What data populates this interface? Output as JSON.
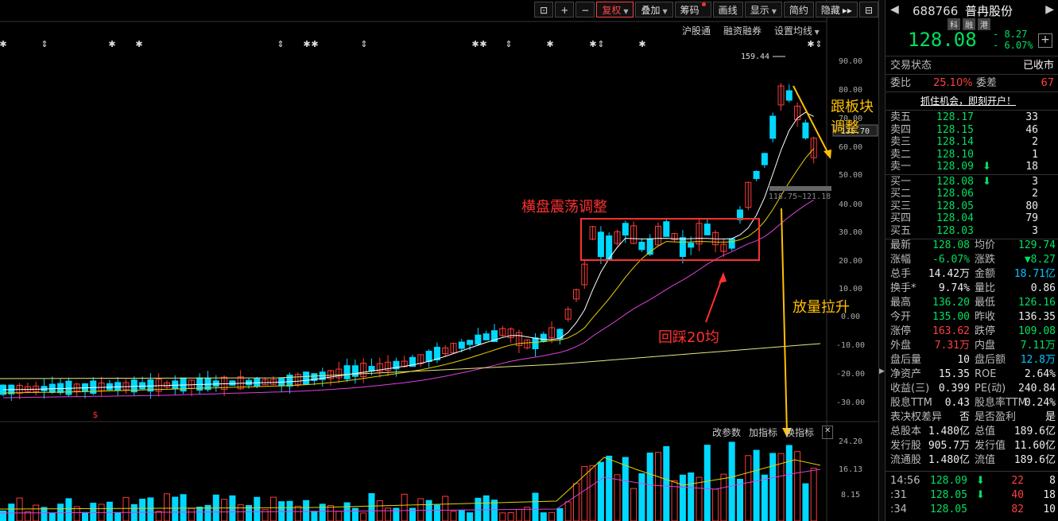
{
  "toolbar": {
    "buttons": [
      "复权",
      "叠加",
      "筹码",
      "画线",
      "显示",
      "简约",
      "隐藏"
    ]
  },
  "subtools": [
    "沪股通",
    "融资融券",
    "设置均线"
  ],
  "volume_tools": [
    "改参数",
    "加指标",
    "换指标"
  ],
  "annotations": {
    "sideways": "横盘震荡调整",
    "pullback": "回踩20均",
    "sector": "跟板块调整",
    "volume": "放量拉升",
    "high_marker": "159.44",
    "range_label": "118.75~121.18",
    "price_tag": "135.70",
    "s_marker": "$"
  },
  "price_axis": [
    "90.00",
    "80.00",
    "70.00",
    "60.00",
    "50.00",
    "40.00",
    "30.00",
    "20.00",
    "10.00",
    "0.00",
    "-10.00",
    "-20.00",
    "-30.00"
  ],
  "volume_axis": [
    "24.20",
    "16.13",
    "8.15"
  ],
  "quote": {
    "code": "688766",
    "name": "普冉股份",
    "tags": [
      "科",
      "融",
      "港"
    ],
    "price": "128.08",
    "change": "- 8.27",
    "change_pct": "- 6.07%",
    "status_label": "交易状态",
    "status_value": "已收市",
    "weibi_label": "委比",
    "weibi_value": "25.10%",
    "weicha_label": "委差",
    "weicha_value": "67",
    "promo": "抓住机会，即刻开户！",
    "sell": [
      {
        "label": "卖五",
        "price": "128.17",
        "vol": "33"
      },
      {
        "label": "卖四",
        "price": "128.15",
        "vol": "46"
      },
      {
        "label": "卖三",
        "price": "128.14",
        "vol": "2"
      },
      {
        "label": "卖二",
        "price": "128.10",
        "vol": "1"
      },
      {
        "label": "卖一",
        "price": "128.09",
        "vol": "18"
      }
    ],
    "buy": [
      {
        "label": "买一",
        "price": "128.08",
        "vol": "3"
      },
      {
        "label": "买二",
        "price": "128.06",
        "vol": "2"
      },
      {
        "label": "买三",
        "price": "128.05",
        "vol": "80"
      },
      {
        "label": "买四",
        "price": "128.04",
        "vol": "79"
      },
      {
        "label": "买五",
        "price": "128.03",
        "vol": "3"
      }
    ],
    "stats": [
      {
        "l1": "最新",
        "v1": "128.08",
        "c1": "green",
        "l2": "均价",
        "v2": "129.74",
        "c2": "green"
      },
      {
        "l1": "涨幅",
        "v1": "-6.07%",
        "c1": "green",
        "l2": "涨跌",
        "v2": "▼8.27",
        "c2": "green"
      },
      {
        "l1": "总手",
        "v1": "14.42万",
        "c1": "white",
        "l2": "金额",
        "v2": "18.71亿",
        "c2": "cyan"
      },
      {
        "l1": "换手*",
        "v1": "9.74%",
        "c1": "white",
        "l2": "量比",
        "v2": "0.86",
        "c2": "white"
      },
      {
        "l1": "最高",
        "v1": "136.20",
        "c1": "green",
        "l2": "最低",
        "v2": "126.16",
        "c2": "green"
      },
      {
        "l1": "今开",
        "v1": "135.00",
        "c1": "green",
        "l2": "昨收",
        "v2": "136.35",
        "c2": "white"
      },
      {
        "l1": "涨停",
        "v1": "163.62",
        "c1": "red",
        "l2": "跌停",
        "v2": "109.08",
        "c2": "green"
      },
      {
        "l1": "外盘",
        "v1": "7.31万",
        "c1": "red",
        "l2": "内盘",
        "v2": "7.11万",
        "c2": "green"
      },
      {
        "l1": "盘后量",
        "v1": "10",
        "c1": "white",
        "l2": "盘后额",
        "v2": "12.8万",
        "c2": "cyan"
      },
      {
        "l1": "净资产",
        "v1": "15.35",
        "c1": "white",
        "l2": "ROE",
        "v2": "2.64%",
        "c2": "white"
      },
      {
        "l1": "收益(三)",
        "v1": "0.399",
        "c1": "white",
        "l2": "PE(动)",
        "v2": "240.84",
        "c2": "white"
      },
      {
        "l1": "股息TTM",
        "v1": "0.43",
        "c1": "white",
        "l2": "股息率TTM",
        "v2": "0.24%",
        "c2": "white"
      },
      {
        "l1": "表决权差异",
        "v1": "否",
        "c1": "white",
        "l2": "是否盈利",
        "v2": "是",
        "c2": "white"
      },
      {
        "l1": "总股本",
        "v1": "1.480亿",
        "c1": "white",
        "l2": "总值",
        "v2": "189.6亿",
        "c2": "white"
      },
      {
        "l1": "发行股",
        "v1": "905.7万",
        "c1": "white",
        "l2": "发行值",
        "v2": "11.60亿",
        "c2": "white"
      },
      {
        "l1": "流通股",
        "v1": "1.480亿",
        "c1": "white",
        "l2": "流值",
        "v2": "189.6亿",
        "c2": "white"
      }
    ],
    "ticks": [
      {
        "time": "14:56",
        "price": "128.09",
        "dir": "down",
        "vol": "22",
        "n": "8"
      },
      {
        "time": ":31",
        "price": "128.05",
        "dir": "down",
        "vol": "40",
        "n": "18"
      },
      {
        "time": ":34",
        "price": "128.05",
        "dir": "",
        "vol": "82",
        "n": "10"
      }
    ]
  },
  "colors": {
    "up": "#ff3a3a",
    "down": "#00d8ff",
    "ma5": "#ffffff",
    "ma10": "#e8d000",
    "ma20": "#e040e0",
    "ma_long": "#e8e880",
    "annot_red": "#ff3030",
    "annot_yellow": "#ffc000"
  }
}
